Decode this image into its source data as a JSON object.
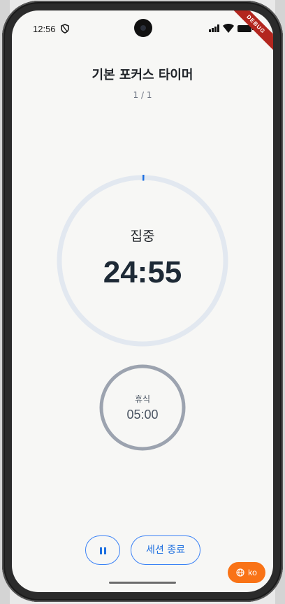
{
  "status": {
    "time": "12:56",
    "debug_label": "DEBUG"
  },
  "header": {
    "title": "기본 포커스 타이머",
    "counter": "1 / 1"
  },
  "focus": {
    "label": "집중",
    "time": "24:55"
  },
  "rest": {
    "label": "휴식",
    "time": "05:00"
  },
  "controls": {
    "end_session_label": "세션 종료"
  },
  "locale_button": {
    "label": "ko"
  },
  "colors": {
    "accent": "#1d6fe0",
    "fab": "#f97316",
    "ring_track": "#e2e8f0",
    "rest_ring": "#9ca3af"
  }
}
